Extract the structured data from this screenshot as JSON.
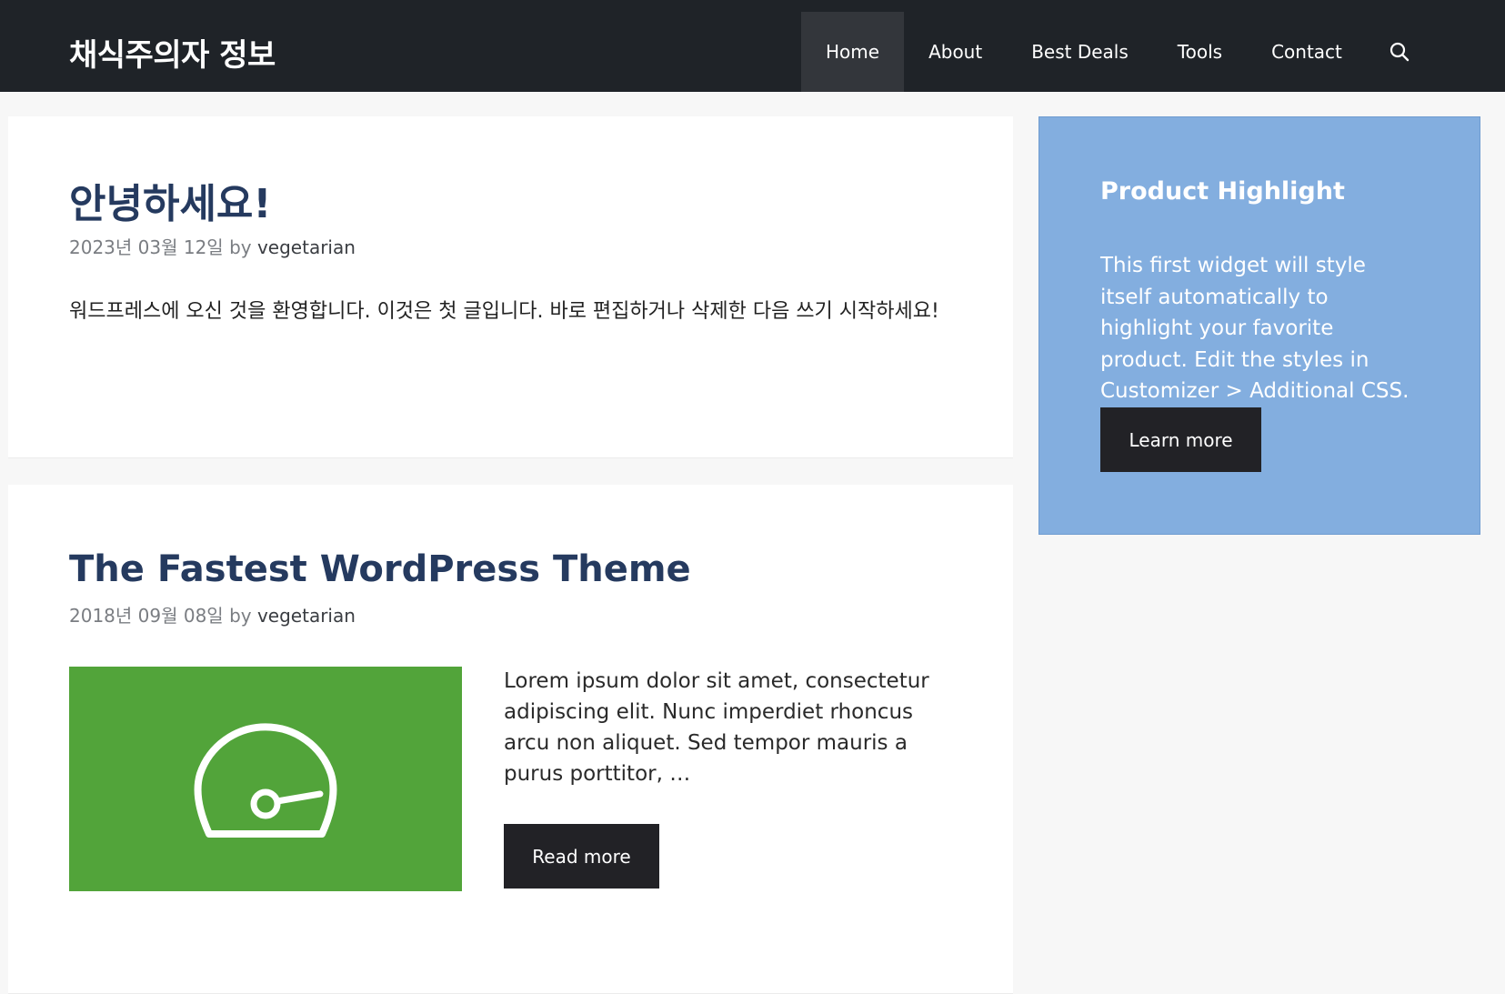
{
  "site": {
    "title": "채식주의자 정보"
  },
  "nav": {
    "items": [
      {
        "label": "Home"
      },
      {
        "label": "About"
      },
      {
        "label": "Best Deals"
      },
      {
        "label": "Tools"
      },
      {
        "label": "Contact"
      }
    ],
    "search_icon": "search-icon"
  },
  "posts": [
    {
      "title": "안녕하세요!",
      "date": "2023년 03월 12일",
      "by": "by",
      "author": "vegetarian",
      "excerpt": "워드프레스에 오신 것을 환영합니다. 이것은 첫 글입니다. 바로 편집하거나 삭제한 다음 쓰기 시작하세요!"
    },
    {
      "title": "The Fastest WordPress Theme",
      "date": "2018년 09월 08일",
      "by": "by",
      "author": "vegetarian",
      "excerpt": "Lorem ipsum dolor sit amet, consectetur adipiscing elit. Nunc imperdiet rhoncus arcu non aliquet. Sed tempor mauris a purus porttitor, …",
      "read_more": "Read more",
      "thumbnail_icon": "speedometer-icon"
    }
  ],
  "widget": {
    "title": "Product Highlight",
    "text": "This first widget will style itself automatically to highlight your favorite product. Edit the styles in Customizer > Additional CSS.",
    "button": "Learn more"
  },
  "colors": {
    "header_bg": "#1f2328",
    "nav_active_bg": "#33363b",
    "title_color": "#253a5f",
    "widget_bg": "#83aedf",
    "thumb_bg": "#52a43a",
    "button_bg": "#222226"
  }
}
